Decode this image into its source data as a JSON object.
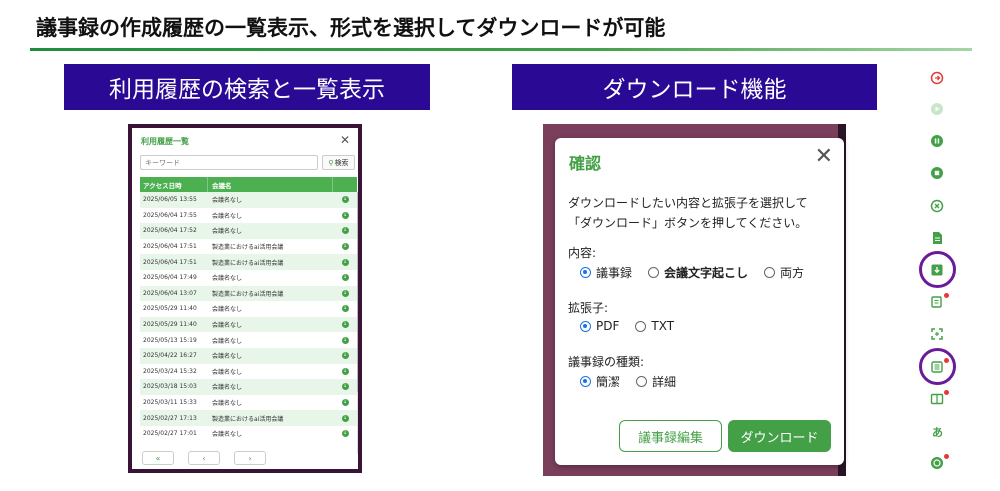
{
  "slide": {
    "title": "議事録の作成履歴の一覧表示、形式を選択してダウンロードが可能"
  },
  "banners": {
    "left": "利用履歴の検索と一覧表示",
    "right": "ダウンロード機能"
  },
  "history": {
    "title": "利用履歴一覧",
    "close": "✕",
    "search_placeholder": "キーワード",
    "search_button": "検索",
    "columns": [
      "アクセス日時",
      "会議名",
      ""
    ],
    "rows": [
      {
        "date": "2025/06/05 13:55",
        "name": "会議名なし"
      },
      {
        "date": "2025/06/04 17:55",
        "name": "会議名なし"
      },
      {
        "date": "2025/06/04 17:52",
        "name": "会議名なし"
      },
      {
        "date": "2025/06/04 17:51",
        "name": "製造業におけるai活用会議"
      },
      {
        "date": "2025/06/04 17:51",
        "name": "製造業におけるai活用会議"
      },
      {
        "date": "2025/06/04 17:49",
        "name": "会議名なし"
      },
      {
        "date": "2025/06/04 13:07",
        "name": "製造業におけるai活用会議"
      },
      {
        "date": "2025/05/29 11:40",
        "name": "会議名なし"
      },
      {
        "date": "2025/05/29 11:40",
        "name": "会議名なし"
      },
      {
        "date": "2025/05/13 15:19",
        "name": "会議名なし"
      },
      {
        "date": "2025/04/22 16:27",
        "name": "会議名なし"
      },
      {
        "date": "2025/03/24 15:32",
        "name": "会議名なし"
      },
      {
        "date": "2025/03/18 15:03",
        "name": "会議名なし"
      },
      {
        "date": "2025/03/11 15:33",
        "name": "会議名なし"
      },
      {
        "date": "2025/02/27 17:13",
        "name": "製造業におけるai活用会議"
      },
      {
        "date": "2025/02/27 17:01",
        "name": "会議名なし"
      }
    ],
    "pager": {
      "first": "«",
      "prev": "‹",
      "next": "›"
    }
  },
  "dialog": {
    "title": "確認",
    "close": "✕",
    "message_line1": "ダウンロードしたい内容と拡張子を選択して",
    "message_line2": "「ダウンロード」ボタンを押してください。",
    "content_label": "内容:",
    "content_options": [
      "議事録",
      "会議文字起こし",
      "両方"
    ],
    "content_selected": "議事録",
    "ext_label": "拡張子:",
    "ext_options": [
      "PDF",
      "TXT"
    ],
    "ext_selected": "PDF",
    "type_label": "議事録の種類:",
    "type_options": [
      "簡潔",
      "詳細"
    ],
    "type_selected": "簡潔",
    "edit_button": "議事録編集",
    "download_button": "ダウンロード"
  },
  "toolbar": {
    "letter_a": "あ",
    "colors": {
      "accent": "#43a047",
      "record": "#e53935",
      "ring": "#6a1b9a",
      "banner": "#2a0a95"
    }
  }
}
